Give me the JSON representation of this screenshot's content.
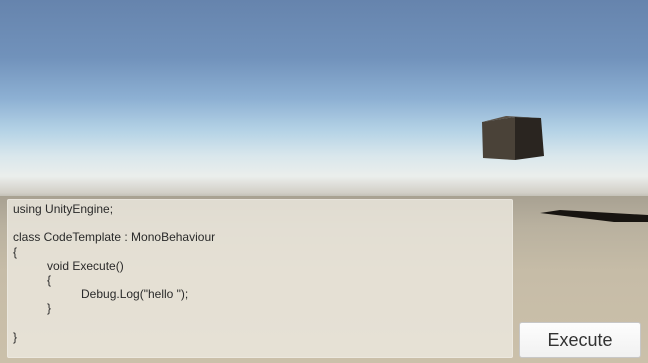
{
  "editor": {
    "lines": [
      {
        "text": "using UnityEngine;",
        "indent": 0
      },
      {
        "text": "",
        "indent": 0
      },
      {
        "text": "class CodeTemplate : MonoBehaviour",
        "indent": 0
      },
      {
        "text": "{",
        "indent": 0
      },
      {
        "text": "void Execute()",
        "indent": 1
      },
      {
        "text": "{",
        "indent": 1
      },
      {
        "text": "Debug.Log(\"hello \");",
        "indent": 2
      },
      {
        "text": "}",
        "indent": 1
      },
      {
        "text": "",
        "indent": 0
      },
      {
        "text": "}",
        "indent": 0
      }
    ]
  },
  "execute_button": {
    "label": "Execute"
  },
  "colors": {
    "sky_top": "#6684ad",
    "horizon": "#ebeeec",
    "ground": "#cbc0aa",
    "cube": "#4a4238",
    "panel": "#ece8de"
  },
  "scene_objects": [
    "cube",
    "cube-shadow"
  ]
}
